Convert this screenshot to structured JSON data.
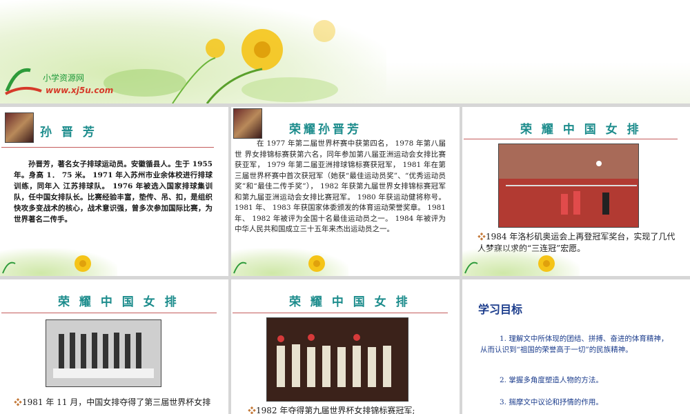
{
  "banner": {
    "brand": "小学资源网",
    "url": "www.xj5u.com"
  },
  "slide1": {
    "title": "孙 晋 芳",
    "body": "孙晋芳，著名女子排球运动员。安徽循县人。生于 1955 年。身高 1． 75 米。 1971 年入苏州市业余体校进行排球训练，同年入 江苏排球队。 1976 年被选入国家排球集训队，任中国女排队长。比赛经验丰富，垫传、吊、扣，是组织快攻多变战术的核心，战术意识强，曾多次参加国际比赛，为世界著名二传手。"
  },
  "slide2": {
    "title": "荣耀孙晋芳",
    "body": "在 1977 年第二届世界杯赛中获第四名， 1978 年第八届世 界女排锦标赛获第六名，同年参加第八届亚洲运动会女排比赛获亚军， 1979 年第二届亚洲排球锦标赛获冠军， 1981 年在第三届世界杯赛中首次获冠军（她获“最佳运动员奖”、“优秀运动员奖”和“最佳二传手奖”）， 1982 年获第九届世界女排锦标赛冠军和第九届亚洲运动会女排比赛冠军。 1980 年获运动健将称号。 1981 年、 1983 年获国家体委颁发的体育运动荣誉奖章。 1981 年、 1982 年被评为全国十名最佳运动员之一。 1984 年被评为中华人民共和国成立三十五年来杰出运动员之一。"
  },
  "slide3": {
    "title": "荣 耀 中 国 女 排",
    "caption": "1984 年洛杉矶奥运会上再登冠军奖台，实现了几代人梦寐以求的“三连冠”宏愿。"
  },
  "slide4": {
    "title": "荣 耀 中 国 女 排",
    "caption": "1981 年 11 月，中国女排夺得了第三届世界杯女排"
  },
  "slide5": {
    "title": "荣 耀 中 国 女 排",
    "caption": "1982 年夺得第九届世界杯女排锦标赛冠军;"
  },
  "slide6": {
    "title": "学习目标",
    "goals": [
      "1. 理解文中所体现的团结、拼搏、奋进的体育精神，从而认识到“祖国的荣誉高于一切”的民族精神。",
      "2. 掌握多角度塑造人物的方法。",
      "3. 揣摩文中议论和抒情的作用。"
    ]
  },
  "colors": {
    "title_teal": "#1c8c8c",
    "goal_blue": "#1b3c8c",
    "rule_red": "#c45a5a"
  }
}
